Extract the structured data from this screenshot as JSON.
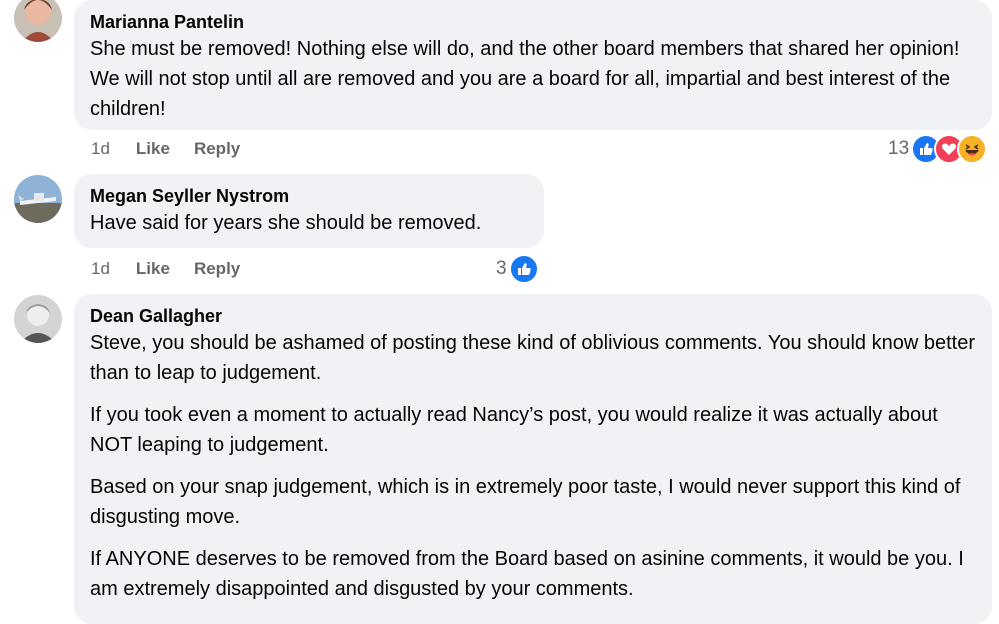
{
  "comments": [
    {
      "author": "Marianna Pantelin",
      "paragraphs": [
        "She must be removed! Nothing else will do, and the other board members that shared her opinion! We will not stop until all are removed and you are a board for all, impartial and best interest of the children!"
      ],
      "time": "1d",
      "like_label": "Like",
      "reply_label": "Reply",
      "reaction_count": "13",
      "reaction_icons": [
        "like-icon",
        "love-icon",
        "haha-icon"
      ]
    },
    {
      "author": "Megan Seyller Nystrom",
      "paragraphs": [
        "Have said for years she should be removed."
      ],
      "time": "1d",
      "like_label": "Like",
      "reply_label": "Reply",
      "reaction_count": "3",
      "reaction_icons": [
        "like-icon"
      ]
    },
    {
      "author": "Dean Gallagher",
      "paragraphs": [
        "Steve, you should be ashamed of posting these kind of oblivious comments. You should know better than to leap to judgement.",
        "If you took even a moment to actually read Nancy’s post, you would realize it was actually about NOT leaping to judgement.",
        "Based on your snap judgement, which is in extremely poor taste, I would never support this kind of disgusting move.",
        "If ANYONE deserves to be removed from the Board based on asinine comments, it would be you. I am extremely disappointed and disgusted by your comments."
      ]
    }
  ],
  "colors": {
    "bubble": "#f0f2f5",
    "like_blue": "#1877f2",
    "love_red": "#f33e58",
    "haha_yellow": "#f7b125",
    "meta_gray": "#65676b"
  }
}
